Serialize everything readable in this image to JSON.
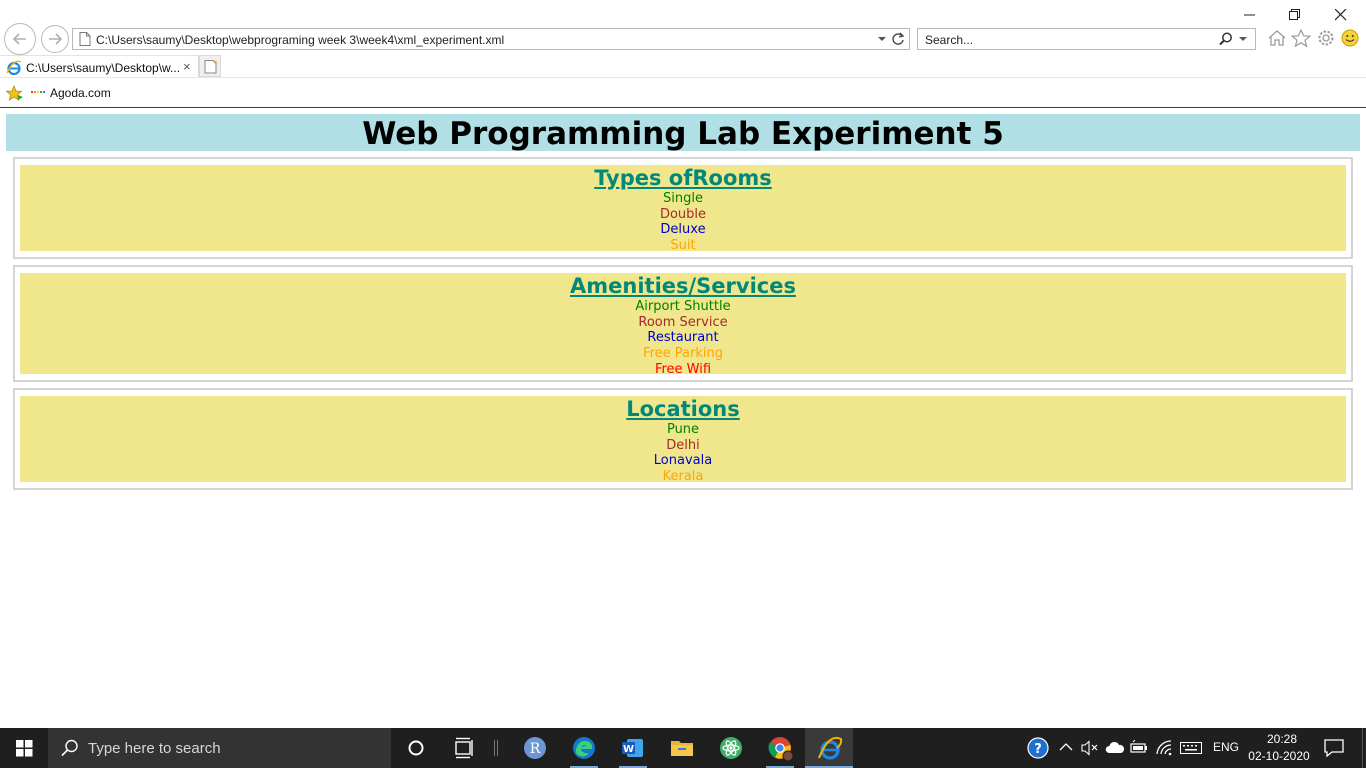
{
  "browser": {
    "address": "C:\\Users\\saumy\\Desktop\\webprograming week 3\\week4\\xml_experiment.xml",
    "search_placeholder": "Search...",
    "tab_title": "C:\\Users\\saumy\\Desktop\\w...",
    "tab_close": "×",
    "favorites": [
      {
        "label": "Agoda.com"
      }
    ]
  },
  "page": {
    "heading": "Web Programming Lab Experiment 5",
    "heading_bg": "#b0e0e6",
    "section_bg": "#f0e68c",
    "title_color": "#00897b",
    "sections": [
      {
        "title": "Types ofRooms",
        "items": [
          {
            "text": "Single",
            "color": "#008000"
          },
          {
            "text": "Double",
            "color": "#a52a2a"
          },
          {
            "text": "Deluxe",
            "color": "#0000cd"
          },
          {
            "text": "Suit",
            "color": "#ffa500"
          }
        ]
      },
      {
        "title": "Amenities/Services",
        "items": [
          {
            "text": "Airport Shuttle",
            "color": "#008000"
          },
          {
            "text": "Room Service",
            "color": "#a52a2a"
          },
          {
            "text": "Restaurant",
            "color": "#0000cd"
          },
          {
            "text": "Free Parking",
            "color": "#ffa500"
          },
          {
            "text": "Free Wifi",
            "color": "#ff0000"
          }
        ]
      },
      {
        "title": "Locations",
        "items": [
          {
            "text": "Pune",
            "color": "#008000"
          },
          {
            "text": "Delhi",
            "color": "#a52a2a"
          },
          {
            "text": "Lonavala",
            "color": "#0000cd"
          },
          {
            "text": "Kerala",
            "color": "#ffa500"
          }
        ]
      }
    ]
  },
  "taskbar": {
    "search_placeholder": "Type here to search",
    "apps": [
      {
        "name": "cortana",
        "icon": "circle-icon"
      },
      {
        "name": "task-view",
        "icon": "task-view-icon"
      },
      {
        "name": "r-app",
        "icon": "r-icon"
      },
      {
        "name": "edge",
        "icon": "edge-icon"
      },
      {
        "name": "word",
        "icon": "word-icon"
      },
      {
        "name": "file-explorer",
        "icon": "folder-icon"
      },
      {
        "name": "atom",
        "icon": "atom-icon"
      },
      {
        "name": "chrome",
        "icon": "chrome-icon"
      },
      {
        "name": "internet-explorer",
        "icon": "ie-icon"
      }
    ],
    "tray": {
      "language": "ENG",
      "time": "20:28",
      "date": "02-10-2020"
    }
  }
}
